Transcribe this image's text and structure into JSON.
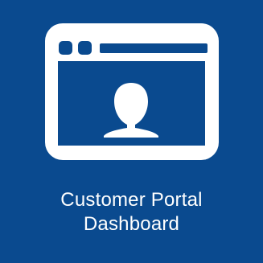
{
  "tile": {
    "background_color": "#0a4a8f",
    "foreground_color": "#ffffff",
    "icon": "browser-window-user-icon",
    "label_line_1": "Customer Portal",
    "label_line_2": "Dashboard"
  }
}
